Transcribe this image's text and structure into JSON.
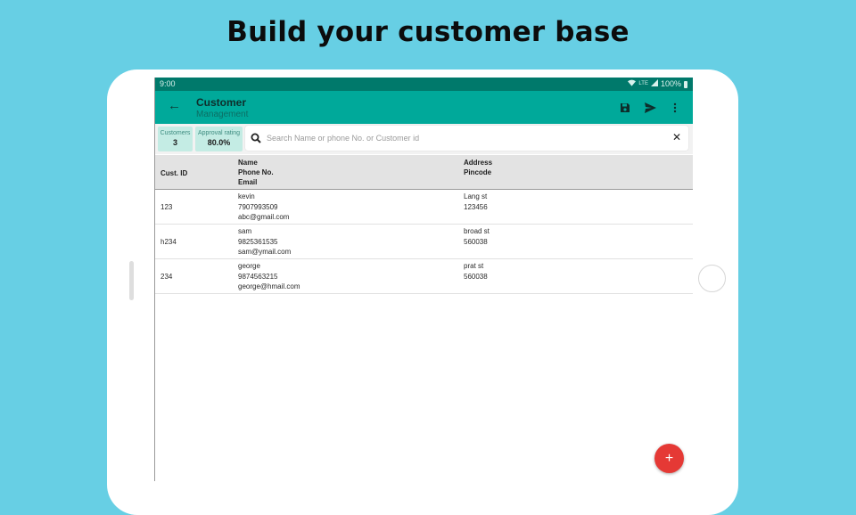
{
  "promo": {
    "title": "Build your customer base"
  },
  "status_bar": {
    "time": "9:00",
    "network": "LTE",
    "battery": "100%"
  },
  "app_bar": {
    "title": "Customer",
    "subtitle": "Management",
    "back_icon": "arrow-left-icon",
    "actions": [
      "save-icon",
      "send-icon",
      "more-vert-icon"
    ]
  },
  "stats": [
    {
      "label": "Customers",
      "value": "3"
    },
    {
      "label": "Approval rating",
      "value": "80.0%"
    }
  ],
  "search": {
    "placeholder": "Search Name or phone No. or Customer id",
    "value": ""
  },
  "table": {
    "headers": {
      "id": "Cust. ID",
      "name": "Name",
      "phone": "Phone No.",
      "email": "Email",
      "address": "Address",
      "pincode": "Pincode"
    },
    "rows": [
      {
        "id": "123",
        "name": "kevin",
        "phone": "7907993509",
        "email": "abc@gmail.com",
        "address": "Lang st",
        "pincode": "123456"
      },
      {
        "id": "h234",
        "name": "sam",
        "phone": "9825361535",
        "email": "sam@ymail.com",
        "address": "broad st",
        "pincode": "560038"
      },
      {
        "id": "234",
        "name": "george",
        "phone": "9874563215",
        "email": "george@hmail.com",
        "address": "prat st",
        "pincode": "560038"
      }
    ]
  },
  "fab": {
    "label": "+",
    "icon": "add-icon"
  },
  "colors": {
    "background": "#67cfe4",
    "status_bar": "#00796b",
    "app_bar": "#00a99a",
    "stat_chip": "#c4ece4",
    "fab": "#e53935"
  }
}
